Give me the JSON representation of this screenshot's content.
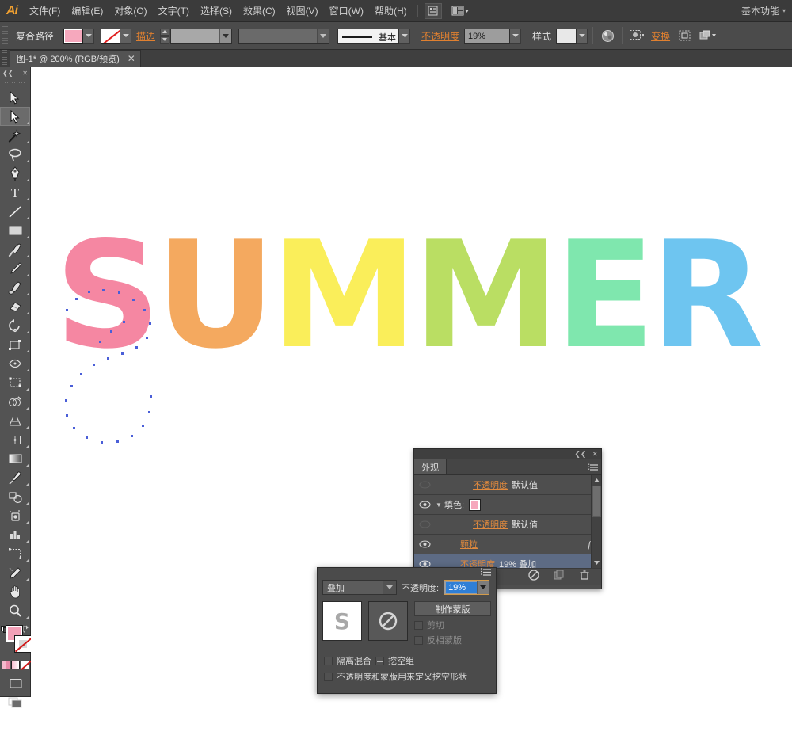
{
  "app": {
    "name": "Adobe Illustrator",
    "logo_text": "Ai"
  },
  "menubar": {
    "items": [
      {
        "label": "文件(F)",
        "name": "menu-file"
      },
      {
        "label": "编辑(E)",
        "name": "menu-edit"
      },
      {
        "label": "对象(O)",
        "name": "menu-object"
      },
      {
        "label": "文字(T)",
        "name": "menu-type"
      },
      {
        "label": "选择(S)",
        "name": "menu-select"
      },
      {
        "label": "效果(C)",
        "name": "menu-effect"
      },
      {
        "label": "视图(V)",
        "name": "menu-view"
      },
      {
        "label": "窗口(W)",
        "name": "menu-window"
      },
      {
        "label": "帮助(H)",
        "name": "menu-help"
      }
    ],
    "bridge_icon": "bridge-icon",
    "arrange_icon": "arrange-documents-icon",
    "workspace": "基本功能",
    "workspace_arrow": "▾"
  },
  "controlbar": {
    "object_type": "复合路径",
    "fill_label": "fill-swatch",
    "fill_color": "#f6a8bd",
    "stroke_label": "stroke-swatch",
    "stroke_value": "无",
    "stroke_weight_label": "描边",
    "stroke_weight_value": "",
    "stroke_profile_value": "",
    "brush_value": "基本",
    "opacity_label": "不透明度",
    "opacity_value": "19%",
    "style_label": "样式",
    "recolor_icon": "recolor-artwork-icon",
    "mask_icon": "opacity-mask-icon",
    "transform_label": "变换",
    "align_icon": "align-icon",
    "arrange_icon": "arrange-icon"
  },
  "tabbar": {
    "document_title": "图-1* @ 200% (RGB/预览)",
    "close": "✕"
  },
  "toolbar": {
    "tools": [
      {
        "name": "selection-tool",
        "label": "选择工具",
        "active": false
      },
      {
        "name": "direct-selection-tool",
        "label": "直接选择工具",
        "active": true
      },
      {
        "name": "magic-wand-tool",
        "label": "魔棒工具",
        "active": false
      },
      {
        "name": "lasso-tool",
        "label": "套索工具",
        "active": false
      },
      {
        "name": "pen-tool",
        "label": "钢笔工具",
        "active": false
      },
      {
        "name": "type-tool",
        "label": "文字工具",
        "active": false
      },
      {
        "name": "line-segment-tool",
        "label": "直线段工具",
        "active": false
      },
      {
        "name": "rectangle-tool",
        "label": "矩形工具",
        "active": false
      },
      {
        "name": "paintbrush-tool",
        "label": "画笔工具",
        "active": false
      },
      {
        "name": "pencil-tool",
        "label": "铅笔工具",
        "active": false
      },
      {
        "name": "blob-brush-tool",
        "label": "斑点画笔工具",
        "active": false
      },
      {
        "name": "eraser-tool",
        "label": "橡皮擦工具",
        "active": false
      },
      {
        "name": "rotate-tool",
        "label": "旋转工具",
        "active": false
      },
      {
        "name": "scale-tool",
        "label": "比例缩放工具",
        "active": false
      },
      {
        "name": "width-tool",
        "label": "宽度工具",
        "active": false
      },
      {
        "name": "free-transform-tool",
        "label": "自由变换工具",
        "active": false
      },
      {
        "name": "shape-builder-tool",
        "label": "形状生成器工具",
        "active": false
      },
      {
        "name": "perspective-grid-tool",
        "label": "透视网格工具",
        "active": false
      },
      {
        "name": "mesh-tool",
        "label": "网格工具",
        "active": false
      },
      {
        "name": "gradient-tool",
        "label": "渐变工具",
        "active": false
      },
      {
        "name": "eyedropper-tool",
        "label": "吸管工具",
        "active": false
      },
      {
        "name": "blend-tool",
        "label": "混合工具",
        "active": false
      },
      {
        "name": "symbol-sprayer-tool",
        "label": "符号喷枪工具",
        "active": false
      },
      {
        "name": "column-graph-tool",
        "label": "柱形图工具",
        "active": false
      },
      {
        "name": "artboard-tool",
        "label": "画板工具",
        "active": false
      },
      {
        "name": "slice-tool",
        "label": "切片工具",
        "active": false
      },
      {
        "name": "hand-tool",
        "label": "抓手工具",
        "active": false
      },
      {
        "name": "zoom-tool",
        "label": "缩放工具",
        "active": false
      }
    ],
    "fill_color": "#f3a0b7",
    "stroke_color": "无",
    "screen_mode": "screen-mode-icon",
    "default_colors": "default-fill-stroke-icon",
    "swap_colors": "swap-fill-stroke-icon"
  },
  "artwork": {
    "letters": [
      {
        "char": "S",
        "color": "#f587a2",
        "selected": true
      },
      {
        "char": "U",
        "color": "#f4a95f",
        "selected": false
      },
      {
        "char": "M",
        "color": "#faee5a",
        "selected": false
      },
      {
        "char": "M",
        "color": "#bade63",
        "selected": false
      },
      {
        "char": "E",
        "color": "#7fe7ae",
        "selected": false
      },
      {
        "char": "R",
        "color": "#6ec5f0",
        "selected": false
      }
    ],
    "word": "SUMMER"
  },
  "appearance_panel": {
    "tab_label": "外观",
    "collapse_icon": "collapse-panel-icon",
    "close_icon": "close-panel-icon",
    "menu_icon": "panel-menu-icon",
    "rows": [
      {
        "name": "appearance-row-opacity-top",
        "visibility": false,
        "label": "不透明度",
        "value": "默认值",
        "selected": false,
        "swatch": false,
        "fx": false
      },
      {
        "name": "appearance-row-fill",
        "visibility": true,
        "label": "填色:",
        "value": "",
        "selected": false,
        "swatch": true,
        "fx": false
      },
      {
        "name": "appearance-row-opacity-fill",
        "visibility": false,
        "label": "不透明度",
        "value": "默认值",
        "selected": false,
        "swatch": false,
        "fx": false
      },
      {
        "name": "appearance-row-grain",
        "visibility": true,
        "label": "颗粒",
        "value": "",
        "selected": false,
        "swatch": false,
        "fx": true
      },
      {
        "name": "appearance-row-opacity-grain",
        "visibility": true,
        "label": "不透明度",
        "value": "19% 叠加",
        "selected": true,
        "swatch": false,
        "fx": false
      }
    ],
    "footer_icons": [
      {
        "name": "clear-appearance-icon"
      },
      {
        "name": "duplicate-item-icon"
      },
      {
        "name": "delete-item-icon"
      }
    ]
  },
  "transparency_dialog": {
    "menu_icon": "panel-menu-icon",
    "blend_mode": "叠加",
    "opacity_label": "不透明度:",
    "opacity_value": "19%",
    "thumbnail_letter": "S",
    "mask_thumbnail": "no-mask-icon",
    "make_mask_button": "制作蒙版",
    "clip_checkbox": "剪切",
    "invert_mask_checkbox": "反相蒙版",
    "isolate_blending": "隔离混合",
    "knockout_group": "挖空组",
    "opacity_define_knockout": "不透明度和蒙版用来定义挖空形状"
  }
}
